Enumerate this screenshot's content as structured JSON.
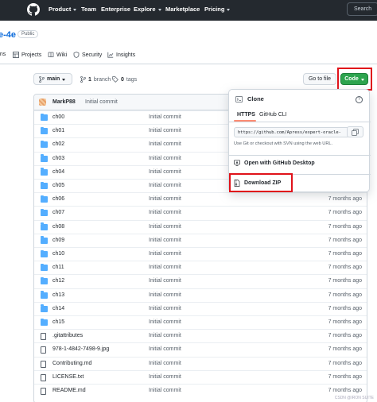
{
  "nav": {
    "items": [
      {
        "label": "Product",
        "caret": true
      },
      {
        "label": "Team",
        "caret": false
      },
      {
        "label": "Enterprise",
        "caret": false
      },
      {
        "label": "Explore",
        "caret": true
      },
      {
        "label": "Marketplace",
        "caret": false
      },
      {
        "label": "Pricing",
        "caret": true
      }
    ],
    "search": "Search"
  },
  "repo": {
    "name_fragment": "e-4e",
    "visibility": "Public",
    "tabs": [
      {
        "label": "ons",
        "icon": "git-pull-request-icon"
      },
      {
        "label": "Projects",
        "icon": "table-icon"
      },
      {
        "label": "Wiki",
        "icon": "book-icon"
      },
      {
        "label": "Security",
        "icon": "shield-icon"
      },
      {
        "label": "Insights",
        "icon": "graph-icon"
      }
    ]
  },
  "branch_bar": {
    "branch": "main",
    "branch_count": "1",
    "branch_label": "branch",
    "tags_count": "0",
    "tags_label": "tags",
    "go_to_file": "Go to file",
    "code_button": "Code"
  },
  "commit": {
    "author": "MarkP88",
    "message": "Initial commit"
  },
  "files": [
    {
      "name": "ch00",
      "type": "folder",
      "message": "Initial commit",
      "age": ""
    },
    {
      "name": "ch01",
      "type": "folder",
      "message": "Initial commit",
      "age": ""
    },
    {
      "name": "ch02",
      "type": "folder",
      "message": "Initial commit",
      "age": ""
    },
    {
      "name": "ch03",
      "type": "folder",
      "message": "Initial commit",
      "age": ""
    },
    {
      "name": "ch04",
      "type": "folder",
      "message": "Initial commit",
      "age": ""
    },
    {
      "name": "ch05",
      "type": "folder",
      "message": "Initial commit",
      "age": ""
    },
    {
      "name": "ch06",
      "type": "folder",
      "message": "Initial commit",
      "age": "7 months ago"
    },
    {
      "name": "ch07",
      "type": "folder",
      "message": "Initial commit",
      "age": "7 months ago"
    },
    {
      "name": "ch08",
      "type": "folder",
      "message": "Initial commit",
      "age": "7 months ago"
    },
    {
      "name": "ch09",
      "type": "folder",
      "message": "Initial commit",
      "age": "7 months ago"
    },
    {
      "name": "ch10",
      "type": "folder",
      "message": "Initial commit",
      "age": "7 months ago"
    },
    {
      "name": "ch11",
      "type": "folder",
      "message": "Initial commit",
      "age": "7 months ago"
    },
    {
      "name": "ch12",
      "type": "folder",
      "message": "Initial commit",
      "age": "7 months ago"
    },
    {
      "name": "ch13",
      "type": "folder",
      "message": "Initial commit",
      "age": "7 months ago"
    },
    {
      "name": "ch14",
      "type": "folder",
      "message": "Initial commit",
      "age": "7 months ago"
    },
    {
      "name": "ch15",
      "type": "folder",
      "message": "Initial commit",
      "age": "7 months ago"
    },
    {
      "name": ".gitattributes",
      "type": "file",
      "message": "Initial commit",
      "age": "7 months ago"
    },
    {
      "name": "978-1-4842-7498-9.jpg",
      "type": "file",
      "message": "Initial commit",
      "age": "7 months ago"
    },
    {
      "name": "Contributing.md",
      "type": "file",
      "message": "Initial commit",
      "age": "7 months ago"
    },
    {
      "name": "LICENSE.txt",
      "type": "file",
      "message": "Initial commit",
      "age": "7 months ago"
    },
    {
      "name": "README.md",
      "type": "file",
      "message": "Initial commit",
      "age": "7 months ago"
    }
  ],
  "clone_menu": {
    "title": "Clone",
    "help": "?",
    "tabs": [
      "HTTPS",
      "GitHub CLI"
    ],
    "url": "https://github.com/Apress/expert-oracle-",
    "hint": "Use Git or checkout with SVN using the web URL.",
    "desktop": "Open with GitHub Desktop",
    "download": "Download ZIP"
  },
  "watermark": "CSDN @IRON SUITE",
  "colors": {
    "nav_bg": "#24292f",
    "link": "#0969da",
    "code_button": "#2da44e",
    "folder": "#54aeff",
    "highlight": "#e0121a"
  }
}
